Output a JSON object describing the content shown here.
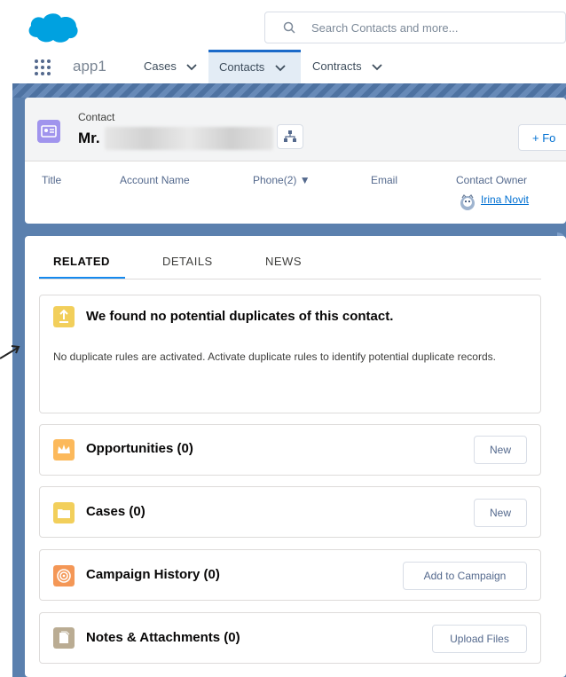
{
  "header": {
    "search_placeholder": "Search Contacts and more...",
    "app_name": "app1"
  },
  "nav": {
    "tabs": [
      {
        "label": "Cases"
      },
      {
        "label": "Contacts"
      },
      {
        "label": "Contracts"
      }
    ]
  },
  "record": {
    "object_label": "Contact",
    "name_prefix": "Mr.",
    "follow_label": "+ Fo",
    "fields": [
      {
        "label": "Title"
      },
      {
        "label": "Account Name"
      },
      {
        "label": "Phone(2) ▼"
      },
      {
        "label": "Email"
      },
      {
        "label": "Contact Owner"
      }
    ],
    "owner_name": "Irina Novit"
  },
  "tabs": [
    {
      "label": "RELATED"
    },
    {
      "label": "DETAILS"
    },
    {
      "label": "NEWS"
    }
  ],
  "duplicates": {
    "title": "We found no potential duplicates of this contact.",
    "message": "No duplicate rules are activated. Activate duplicate rules to identify potential duplicate records."
  },
  "related_lists": [
    {
      "title": "Opportunities (0)",
      "button": "New",
      "icon": "crown-icon",
      "color": "#fcb95b"
    },
    {
      "title": "Cases (0)",
      "button": "New",
      "icon": "folder-icon",
      "color": "#f2cf5b"
    },
    {
      "title": "Campaign History (0)",
      "button": "Add to Campaign",
      "icon": "target-icon",
      "color": "#f49756"
    },
    {
      "title": "Notes & Attachments (0)",
      "button": "Upload Files",
      "icon": "document-icon",
      "color": "#baac93"
    }
  ],
  "colors": {
    "brand_blue": "#00a1e0",
    "link_blue": "#0070d2",
    "contact_icon": "#a094ed",
    "dup_icon": "#f2cf5b"
  }
}
